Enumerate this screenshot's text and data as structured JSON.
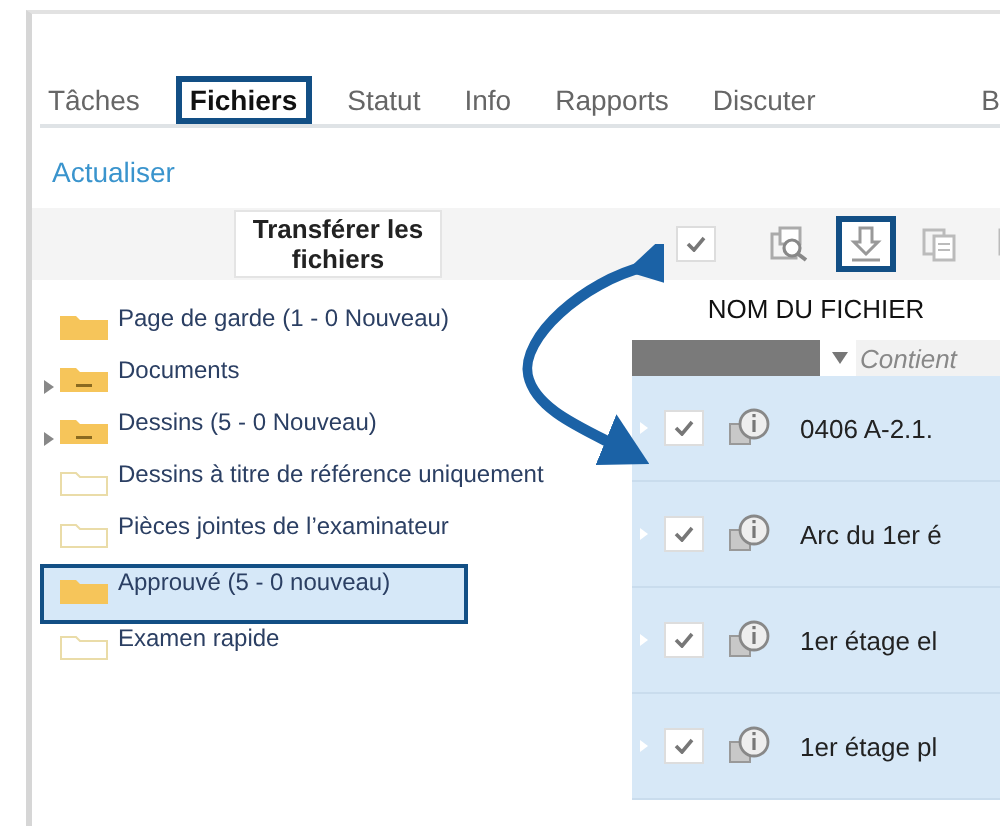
{
  "tabs": [
    {
      "label": "Tâches",
      "selected": false,
      "highlighted": false
    },
    {
      "label": "Fichiers",
      "selected": true,
      "highlighted": true
    },
    {
      "label": "Statut",
      "selected": false,
      "highlighted": false
    },
    {
      "label": "Info",
      "selected": false,
      "highlighted": false
    },
    {
      "label": "Rapports",
      "selected": false,
      "highlighted": false
    },
    {
      "label": "Discuter",
      "selected": false,
      "highlighted": false
    },
    {
      "label": "B",
      "selected": false,
      "highlighted": false
    }
  ],
  "refresh_link": "Actualiser",
  "toolbar": {
    "upload_button": "Transférer les fichiers",
    "select_all_checked": true,
    "tools": [
      {
        "kind": "preview",
        "highlighted": false
      },
      {
        "kind": "download",
        "highlighted": true
      },
      {
        "kind": "copy",
        "highlighted": false
      },
      {
        "kind": "copy",
        "highlighted": false
      }
    ]
  },
  "tree": [
    {
      "label": "Page de garde (1 - 0 Nouveau)",
      "kind": "filled",
      "has_children": false,
      "selected": false,
      "highlighted": false
    },
    {
      "label": "Documents",
      "kind": "filled",
      "has_children": true,
      "selected": false,
      "highlighted": false
    },
    {
      "label": "Dessins (5 - 0 Nouveau)",
      "kind": "filled",
      "has_children": true,
      "selected": false,
      "highlighted": false
    },
    {
      "label": "Dessins à titre de référence uniquement",
      "kind": "outline",
      "has_children": false,
      "selected": false,
      "highlighted": false
    },
    {
      "label": "Pièces jointes de l’examinateur",
      "kind": "outline",
      "has_children": false,
      "selected": false,
      "highlighted": false
    },
    {
      "label": "Approuvé (5 - 0 nouveau)",
      "kind": "filled",
      "has_children": false,
      "selected": true,
      "highlighted": true
    },
    {
      "label": "Examen rapide",
      "kind": "outline",
      "has_children": false,
      "selected": false,
      "highlighted": false
    }
  ],
  "table": {
    "column_header": "NOM DU FICHIER",
    "filter_placeholder": "Contient",
    "rows": [
      {
        "name": "0406 A-2.1.",
        "checked": true
      },
      {
        "name": "Arc du 1er é",
        "checked": true
      },
      {
        "name": "1er étage el",
        "checked": true
      },
      {
        "name": "1er étage pl",
        "checked": true
      }
    ]
  }
}
